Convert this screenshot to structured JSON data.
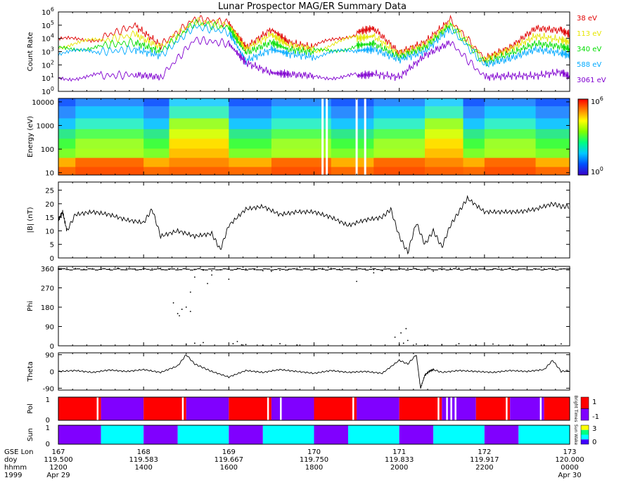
{
  "title": "Lunar Prospector MAG/ER Summary Data",
  "chart_data": [
    {
      "type": "line",
      "id": "count-rate",
      "ylabel": "Count Rate",
      "yscale": "log",
      "ylim": [
        1,
        1000000
      ],
      "yticks": [
        {
          "p": "10",
          "e": "0"
        },
        {
          "p": "10",
          "e": "1"
        },
        {
          "p": "10",
          "e": "2"
        },
        {
          "p": "10",
          "e": "3"
        },
        {
          "p": "10",
          "e": "4"
        },
        {
          "p": "10",
          "e": "5"
        },
        {
          "p": "10",
          "e": "6"
        }
      ],
      "xlim": [
        167,
        173
      ],
      "series": [
        {
          "name": "38 eV",
          "color": "#e00000",
          "x": [
            167,
            167.5,
            167.9,
            168.2,
            168.6,
            169.0,
            169.2,
            169.5,
            169.7,
            170.0,
            170.5,
            170.7,
            171.0,
            171.3,
            171.6,
            172.0,
            172.3,
            172.6,
            172.9,
            173
          ],
          "y": [
            6000,
            12000,
            90000,
            3000,
            300000,
            150000,
            2000,
            50000,
            5000,
            2000,
            30000,
            60000,
            800,
            5000,
            250000,
            300,
            2000,
            60000,
            40000,
            20000
          ]
        },
        {
          "name": "113 eV",
          "color": "#e6e600",
          "x": [
            167,
            167.5,
            167.9,
            168.2,
            168.6,
            169.0,
            169.2,
            169.5,
            169.7,
            170.0,
            170.5,
            170.7,
            171.0,
            171.3,
            171.6,
            172.0,
            172.3,
            172.6,
            172.9,
            173
          ],
          "y": [
            3000,
            6000,
            20000,
            2000,
            200000,
            100000,
            1500,
            20000,
            3000,
            1500,
            10000,
            15000,
            600,
            3000,
            150000,
            250,
            1500,
            15000,
            8000,
            5000
          ]
        },
        {
          "name": "340 eV",
          "color": "#00dd00",
          "x": [
            167,
            167.5,
            167.9,
            168.2,
            168.6,
            169.0,
            169.2,
            169.5,
            169.7,
            170.0,
            170.5,
            170.7,
            171.0,
            171.3,
            171.6,
            172.0,
            172.3,
            172.6,
            172.9,
            173
          ],
          "y": [
            1500,
            3000,
            5000,
            1000,
            150000,
            60000,
            800,
            5000,
            1500,
            900,
            3000,
            4000,
            400,
            2000,
            100000,
            150,
            700,
            4000,
            2500,
            1500
          ]
        },
        {
          "name": "588 eV",
          "color": "#00aaff",
          "x": [
            167,
            167.5,
            167.9,
            168.2,
            168.6,
            169.0,
            169.2,
            169.5,
            169.7,
            170.0,
            170.5,
            170.7,
            171.0,
            171.3,
            171.6,
            172.0,
            172.3,
            172.6,
            172.9,
            173
          ],
          "y": [
            700,
            1000,
            1500,
            500,
            80000,
            30000,
            200,
            1500,
            700,
            400,
            1200,
            1500,
            250,
            1000,
            60000,
            100,
            300,
            1500,
            800,
            500
          ]
        },
        {
          "name": "3061 eV",
          "color": "#8000d0",
          "x": [
            167,
            167.5,
            167.9,
            168.2,
            168.6,
            169.0,
            169.2,
            169.5,
            169.7,
            170.0,
            170.5,
            170.7,
            171.0,
            171.3,
            171.6,
            172.0,
            172.3,
            172.6,
            172.9,
            173
          ],
          "y": [
            12,
            15,
            18,
            12,
            8000,
            4000,
            150,
            25,
            20,
            15,
            15,
            20,
            12,
            500,
            5000,
            12,
            15,
            15,
            30,
            12
          ]
        }
      ]
    },
    {
      "type": "heatmap",
      "id": "energy-spectrogram",
      "ylabel": "Energy (eV)",
      "yscale": "log",
      "ylim": [
        8,
        14000
      ],
      "yticks": [
        "10",
        "100",
        "1000",
        "10000"
      ],
      "colorbar": {
        "min": {
          "p": "10",
          "e": "0"
        },
        "max": {
          "p": "10",
          "e": "6"
        }
      },
      "intervals": [
        {
          "x0": 167.0,
          "x1": 167.2,
          "state": "mid"
        },
        {
          "x0": 167.2,
          "x1": 168.0,
          "state": "high"
        },
        {
          "x0": 168.0,
          "x1": 168.3,
          "state": "mid"
        },
        {
          "x0": 168.3,
          "x1": 169.0,
          "state": "very-high"
        },
        {
          "x0": 169.0,
          "x1": 169.5,
          "state": "mid"
        },
        {
          "x0": 169.5,
          "x1": 170.2,
          "state": "high"
        },
        {
          "x0": 170.2,
          "x1": 170.7,
          "state": "mid"
        },
        {
          "x0": 170.7,
          "x1": 171.3,
          "state": "high"
        },
        {
          "x0": 171.3,
          "x1": 171.75,
          "state": "very-high"
        },
        {
          "x0": 171.75,
          "x1": 172.0,
          "state": "mid"
        },
        {
          "x0": 172.0,
          "x1": 172.6,
          "state": "high"
        },
        {
          "x0": 172.6,
          "x1": 173.0,
          "state": "mid"
        }
      ],
      "gaps": [
        170.1,
        170.15,
        170.5,
        170.6
      ]
    },
    {
      "type": "line",
      "id": "b-magnitude",
      "ylabel": "|B| (nT)",
      "ylim": [
        0,
        28
      ],
      "yticks": [
        0,
        5,
        10,
        15,
        20,
        25
      ],
      "x": [
        167,
        167.05,
        167.1,
        167.2,
        167.4,
        167.6,
        167.8,
        168.0,
        168.1,
        168.2,
        168.4,
        168.6,
        168.8,
        168.9,
        169.0,
        169.2,
        169.4,
        169.6,
        169.8,
        170.0,
        170.2,
        170.4,
        170.6,
        170.8,
        170.9,
        171.0,
        171.1,
        171.2,
        171.3,
        171.4,
        171.5,
        171.6,
        171.7,
        171.8,
        172.0,
        172.2,
        172.4,
        172.6,
        172.8,
        172.9,
        173.0
      ],
      "y": [
        14,
        17,
        10,
        16,
        17,
        16,
        14,
        13,
        18,
        8,
        10,
        8,
        9,
        3,
        12,
        18,
        19,
        16,
        17,
        17,
        15,
        12,
        14,
        15,
        18,
        8,
        2,
        13,
        5,
        10,
        4,
        12,
        17,
        22,
        17,
        17,
        17,
        18,
        20,
        19,
        19
      ]
    },
    {
      "type": "scatter",
      "id": "phi",
      "ylabel": "Phi",
      "ylim": [
        0,
        370
      ],
      "yticks": [
        0,
        90,
        180,
        270,
        360
      ],
      "x": [
        167.0,
        167.1,
        167.2,
        167.3,
        167.4,
        167.5,
        167.6,
        167.7,
        167.8,
        167.9,
        168.0,
        168.1,
        168.2,
        168.3,
        168.4,
        168.5,
        168.6,
        168.7,
        168.8,
        168.9,
        169.0,
        169.1,
        169.2,
        169.3,
        169.4,
        169.5,
        169.6,
        169.7,
        169.8,
        169.9,
        170.0,
        170.1,
        170.2,
        170.3,
        170.4,
        170.5,
        170.6,
        170.7,
        170.8,
        170.9,
        171.0,
        171.1,
        171.2,
        171.3,
        171.4,
        171.5,
        171.6,
        171.7,
        171.8,
        171.9,
        172.0,
        172.1,
        172.2,
        172.3,
        172.4,
        172.5,
        172.6,
        172.7,
        172.8,
        172.9,
        173.0,
        168.4,
        168.45,
        168.5,
        168.55,
        168.42,
        169.05,
        169.1,
        169.15,
        168.5,
        168.6,
        168.7,
        169.2,
        169.4,
        169.6,
        169.8,
        171.0,
        171.05,
        171.1,
        171.2,
        171.3,
        171.5,
        171.7,
        171.9,
        172.1,
        172.3,
        172.5,
        172.7,
        172.9,
        168.6,
        168.8,
        169.0,
        170.95,
        171.02,
        171.08,
        170.5,
        170.7,
        168.35,
        168.55,
        168.75
      ],
      "y": [
        358,
        362,
        360,
        357,
        359,
        361,
        358,
        362,
        360,
        358,
        357,
        359,
        361,
        356,
        360,
        358,
        355,
        352,
        350,
        354,
        357,
        360,
        358,
        355,
        350,
        347,
        352,
        356,
        360,
        359,
        358,
        360,
        361,
        357,
        359,
        362,
        358,
        355,
        350,
        353,
        357,
        360,
        358,
        352,
        348,
        355,
        360,
        361,
        358,
        359,
        360,
        357,
        359,
        362,
        358,
        360,
        357,
        359,
        361,
        358,
        360,
        150,
        170,
        180,
        160,
        140,
        10,
        20,
        5,
        8,
        12,
        15,
        6,
        3,
        10,
        4,
        5,
        12,
        25,
        8,
        3,
        6,
        10,
        4,
        8,
        3,
        7,
        4,
        9,
        320,
        330,
        310,
        40,
        60,
        80,
        300,
        340,
        200,
        250,
        290
      ]
    },
    {
      "type": "line",
      "id": "theta",
      "ylabel": "Theta",
      "ylim": [
        -100,
        100
      ],
      "yticks": [
        "-90",
        "0",
        "90"
      ],
      "x": [
        167,
        167.2,
        167.4,
        167.6,
        167.8,
        168.0,
        168.2,
        168.4,
        168.5,
        168.6,
        168.7,
        168.8,
        169.0,
        169.2,
        169.4,
        169.6,
        169.8,
        170.0,
        170.2,
        170.4,
        170.6,
        170.8,
        171.0,
        171.1,
        171.2,
        171.25,
        171.3,
        171.35,
        171.4,
        171.5,
        171.7,
        171.9,
        172.1,
        172.3,
        172.5,
        172.7,
        172.8,
        172.9,
        173.0
      ],
      "y": [
        0,
        5,
        -5,
        8,
        0,
        10,
        -5,
        30,
        90,
        40,
        20,
        0,
        -30,
        5,
        -5,
        10,
        0,
        -10,
        5,
        -5,
        0,
        -10,
        60,
        40,
        90,
        -90,
        -20,
        0,
        10,
        -5,
        5,
        0,
        -5,
        5,
        0,
        10,
        60,
        0,
        5
      ]
    },
    {
      "type": "bar",
      "id": "polarity",
      "ylabel": "Pol",
      "ylim": [
        0,
        1
      ],
      "yticks": [
        "0",
        "1"
      ],
      "colorbar": {
        "ticks": [
          "1",
          "-1"
        ]
      },
      "vertical_text": "Bright Times",
      "segments": [
        {
          "x0": 167.0,
          "x1": 167.5,
          "value": 1
        },
        {
          "x0": 167.5,
          "x1": 168.0,
          "value": -1
        },
        {
          "x0": 168.0,
          "x1": 168.5,
          "value": 1
        },
        {
          "x0": 168.5,
          "x1": 169.0,
          "value": -1
        },
        {
          "x0": 169.0,
          "x1": 169.5,
          "value": 1
        },
        {
          "x0": 169.5,
          "x1": 170.0,
          "value": -1
        },
        {
          "x0": 170.0,
          "x1": 170.5,
          "value": 1
        },
        {
          "x0": 170.5,
          "x1": 171.0,
          "value": -1
        },
        {
          "x0": 171.0,
          "x1": 171.5,
          "value": 1
        },
        {
          "x0": 171.5,
          "x1": 171.9,
          "value": -1
        },
        {
          "x0": 171.9,
          "x1": 172.3,
          "value": 1
        },
        {
          "x0": 172.3,
          "x1": 172.7,
          "value": -1
        },
        {
          "x0": 172.7,
          "x1": 173.0,
          "value": 1
        }
      ]
    },
    {
      "type": "bar",
      "id": "sun",
      "ylabel": "Sun",
      "ylim": [
        0,
        1
      ],
      "yticks": [
        "0",
        "1"
      ],
      "colorbar": {
        "ticks": [
          "3",
          "2",
          "1",
          "0"
        ]
      },
      "vertical_text": "Sun Wake",
      "segments": [
        {
          "x0": 167.0,
          "x1": 167.5,
          "value": 0
        },
        {
          "x0": 167.5,
          "x1": 168.0,
          "value": 3
        },
        {
          "x0": 168.0,
          "x1": 168.4,
          "value": 0
        },
        {
          "x0": 168.4,
          "x1": 169.0,
          "value": 3
        },
        {
          "x0": 169.0,
          "x1": 169.4,
          "value": 0
        },
        {
          "x0": 169.4,
          "x1": 170.0,
          "value": 3
        },
        {
          "x0": 170.0,
          "x1": 170.4,
          "value": 0
        },
        {
          "x0": 170.4,
          "x1": 171.0,
          "value": 3
        },
        {
          "x0": 171.0,
          "x1": 171.4,
          "value": 0
        },
        {
          "x0": 171.4,
          "x1": 172.0,
          "value": 3
        },
        {
          "x0": 172.0,
          "x1": 172.4,
          "value": 0
        },
        {
          "x0": 172.4,
          "x1": 173.0,
          "value": 3
        }
      ]
    }
  ],
  "time_axis": {
    "row_labels": [
      "GSE Lon",
      "doy",
      "hhmm",
      "1999"
    ],
    "columns": [
      {
        "lon": "167",
        "doy": "119.500",
        "hhmm": "1200",
        "date": "Apr 29"
      },
      {
        "lon": "168",
        "doy": "119.583",
        "hhmm": "1400",
        "date": ""
      },
      {
        "lon": "169",
        "doy": "119.667",
        "hhmm": "1600",
        "date": ""
      },
      {
        "lon": "170",
        "doy": "119.750",
        "hhmm": "1800",
        "date": ""
      },
      {
        "lon": "171",
        "doy": "119.833",
        "hhmm": "2000",
        "date": ""
      },
      {
        "lon": "172",
        "doy": "119.917",
        "hhmm": "2200",
        "date": ""
      },
      {
        "lon": "173",
        "doy": "120.000",
        "hhmm": "0000",
        "date": "Apr 30"
      }
    ]
  }
}
